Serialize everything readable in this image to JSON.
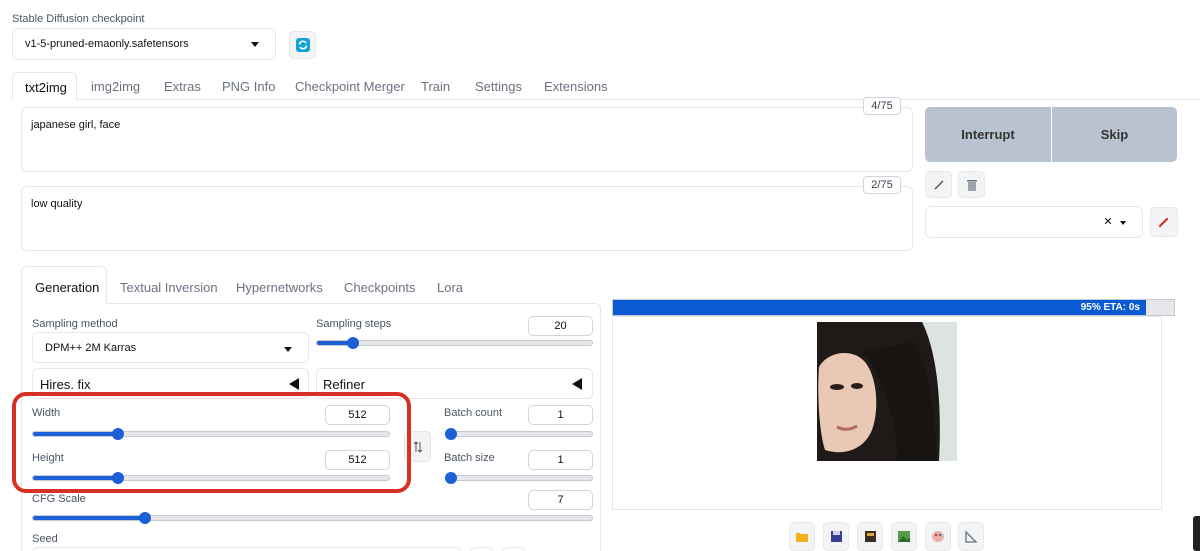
{
  "checkpoint": {
    "label": "Stable Diffusion checkpoint",
    "value": "v1-5-pruned-emaonly.safetensors"
  },
  "main_tabs": [
    "txt2img",
    "img2img",
    "Extras",
    "PNG Info",
    "Checkpoint Merger",
    "Train",
    "Settings",
    "Extensions"
  ],
  "prompt": {
    "text": "japanese girl, face",
    "token_count": "4/75"
  },
  "negative_prompt": {
    "text": "low quality",
    "token_count": "2/75"
  },
  "actions": {
    "interrupt": "Interrupt",
    "skip": "Skip"
  },
  "sub_tabs": [
    "Generation",
    "Textual Inversion",
    "Hypernetworks",
    "Checkpoints",
    "Lora"
  ],
  "sampling": {
    "method_label": "Sampling method",
    "method_value": "DPM++ 2M Karras",
    "steps_label": "Sampling steps",
    "steps_value": "20",
    "steps_fraction": 0.13
  },
  "hires": {
    "label": "Hires. fix"
  },
  "refiner": {
    "label": "Refiner"
  },
  "width": {
    "label": "Width",
    "value": "512",
    "fraction": 0.24
  },
  "height": {
    "label": "Height",
    "value": "512",
    "fraction": 0.24
  },
  "batch_count": {
    "label": "Batch count",
    "value": "1",
    "fraction": 0.0
  },
  "batch_size": {
    "label": "Batch size",
    "value": "1",
    "fraction": 0.0
  },
  "cfg": {
    "label": "CFG Scale",
    "value": "7",
    "fraction": 0.2
  },
  "seed": {
    "label": "Seed"
  },
  "progress": {
    "text": "95% ETA: 0s",
    "fraction": 0.95
  },
  "colors": {
    "accent": "#1d5fd6",
    "highlight": "#d93025",
    "progress": "#0a5bd3"
  }
}
